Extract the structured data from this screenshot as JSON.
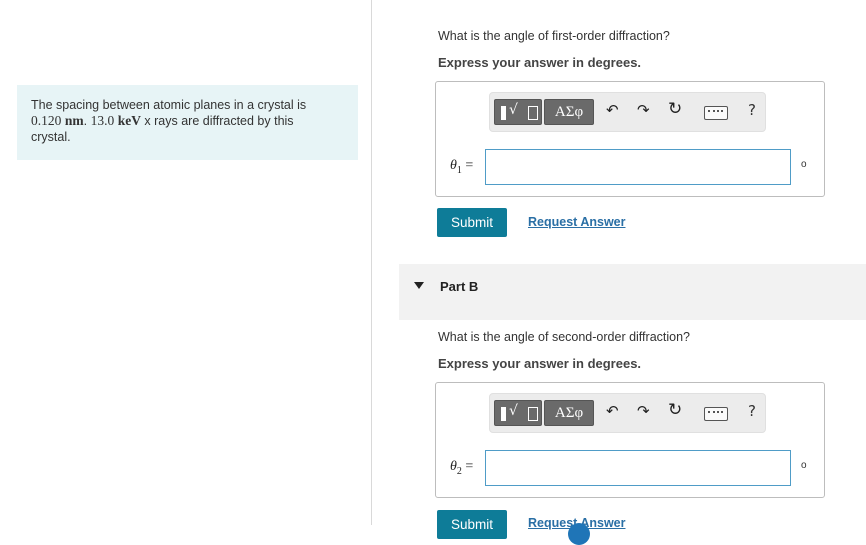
{
  "problem": {
    "text_1": "The spacing between atomic planes in a crystal is",
    "spacing_value": "0.120",
    "spacing_unit": "nm",
    "sep": ". ",
    "energy_value": "13.0",
    "energy_unit": "keV",
    "text_2": " x rays are diffracted by this",
    "text_3": "crystal."
  },
  "part_a": {
    "question": "What is the angle of first-order diffraction?",
    "instruction": "Express your answer in degrees.",
    "variable": "θ",
    "variable_sub": "1",
    "equals": "=",
    "input_value": "",
    "unit": "o",
    "submit_label": "Submit",
    "request_label": "Request Answer"
  },
  "part_b": {
    "title": "Part B",
    "question": "What is the angle of second-order diffraction?",
    "instruction": "Express your answer in degrees.",
    "variable": "θ",
    "variable_sub": "2",
    "equals": "=",
    "input_value": "",
    "unit": "o",
    "submit_label": "Submit",
    "request_label": "Request Answer"
  },
  "toolbar": {
    "greek_label": "ΑΣφ",
    "undo_icon": "undo-icon",
    "redo_icon": "redo-icon",
    "reset_icon": "reset-icon",
    "keyboard_icon": "keyboard-icon",
    "help_label": "?"
  },
  "colors": {
    "problem_bg": "#e7f4f6",
    "submit_bg": "#0e7c98",
    "link": "#2a6fa5",
    "input_border": "#4f9cc7"
  }
}
